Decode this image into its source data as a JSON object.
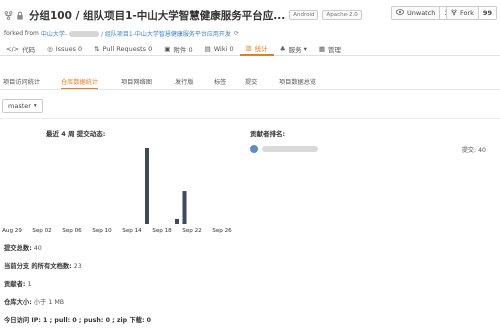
{
  "header": {
    "title": "分组100 / 组队项目1-中山大学智慧健康服务平台应...",
    "badges": [
      "Android",
      "Apache-2.0"
    ],
    "fork_prefix": "forked from",
    "fork_source_a": "中山大学-",
    "fork_source_b": "/ 组队项目1-中山大学智慧健康服务平台应用开发",
    "unwatch_label": "Unwatch",
    "unwatch_count": "1",
    "fork_label": "Fork",
    "fork_count": "99"
  },
  "nav": {
    "items": [
      {
        "label": "代码",
        "icon": "code-icon"
      },
      {
        "label": "Issues 0",
        "icon": "issue-icon"
      },
      {
        "label": "Pull Requests 0",
        "icon": "pull-request-icon"
      },
      {
        "label": "附件 0",
        "icon": "attachment-icon"
      },
      {
        "label": "Wiki 0",
        "icon": "wiki-icon"
      },
      {
        "label": "统计",
        "icon": "stats-icon"
      },
      {
        "label": "服务",
        "icon": "service-icon"
      },
      {
        "label": "管理",
        "icon": "settings-icon"
      }
    ],
    "active_index": 5
  },
  "subtabs": {
    "items": [
      "项目访问统计",
      "仓库数据统计",
      "项目网络图",
      "发行版",
      "标签",
      "提交",
      "项目数据总览"
    ],
    "active_index": 1
  },
  "branch": {
    "label": "master"
  },
  "contributors": {
    "title": "贡献者排名:",
    "rows": [
      {
        "commits_label": "提交: 40"
      }
    ]
  },
  "chart_data": {
    "type": "bar",
    "title": "最近 4 周 提交动态:",
    "categories": [
      "Aug 29",
      "Sep 02",
      "Sep 06",
      "Sep 10",
      "Sep 14",
      "Sep 18",
      "Sep 22",
      "Sep 26"
    ],
    "x_ticks": [
      "Aug 29",
      "Sep 02",
      "Sep 06",
      "Sep 10",
      "Sep 14",
      "Sep 18",
      "Sep 22",
      "Sep 26"
    ],
    "bars": [
      {
        "x": "Sep 16",
        "value": 30
      },
      {
        "x": "Sep 20",
        "value": 2
      },
      {
        "x": "Sep 21",
        "value": 13
      }
    ],
    "bar_color": "#3d4a5c",
    "xlabel": "",
    "ylabel": "",
    "ylim": [
      0,
      30
    ]
  },
  "stats": {
    "total_commits_label": "提交总数:",
    "total_commits_value": "40",
    "files_label": "当前分支 的所有文档数:",
    "files_value": "23",
    "contributors_label": "贡献者:",
    "contributors_value": "1",
    "size_label": "仓库大小:",
    "size_value": "小于 1 MB",
    "visits_label": "今日访问 IP: 1 ; pull: 0 ; push: 0 ; zip 下载: 0"
  }
}
